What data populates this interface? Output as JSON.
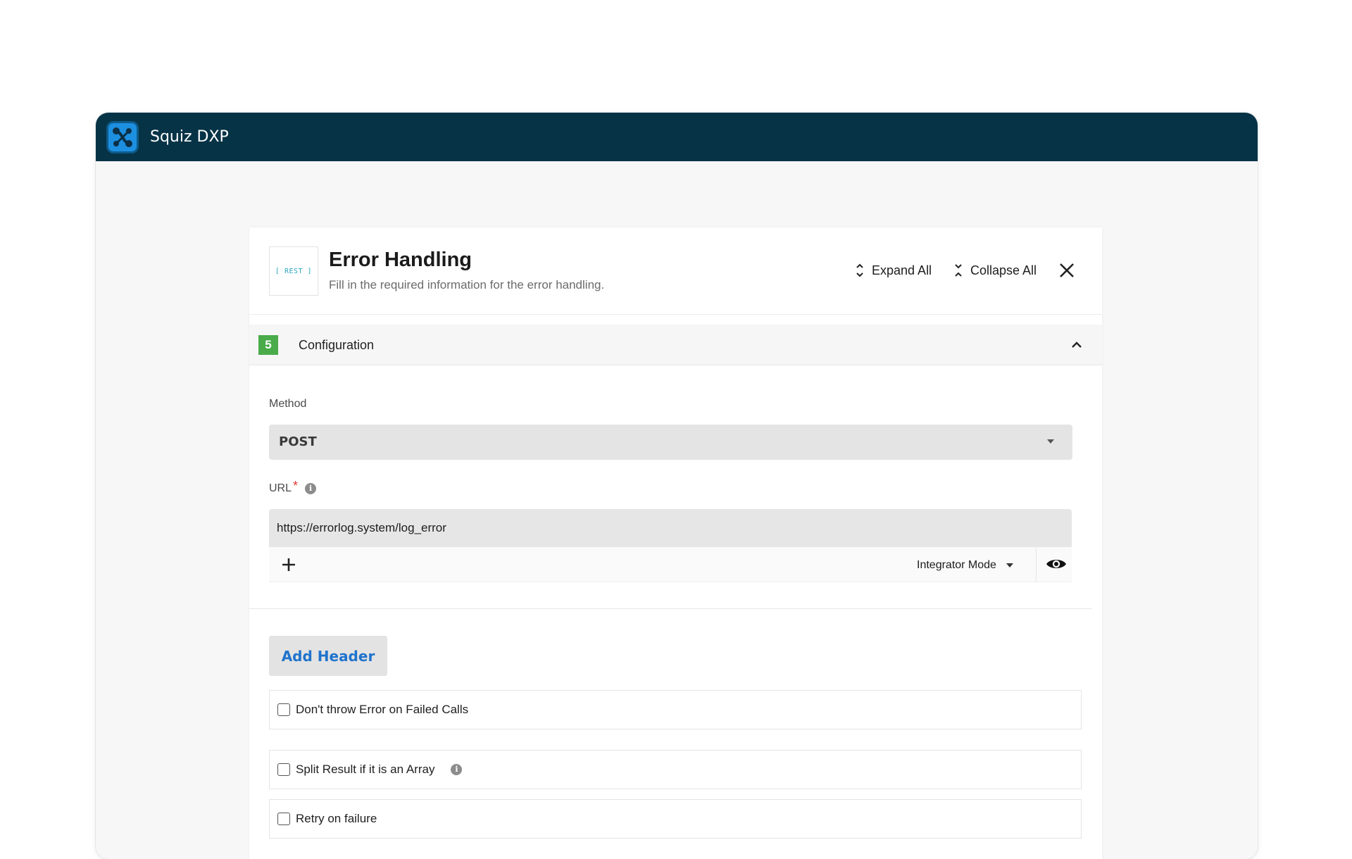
{
  "app": {
    "title": "Squiz DXP",
    "logo_icon": "squiz-logo-icon"
  },
  "panel": {
    "badge": "[ REST ]",
    "title": "Error Handling",
    "subtitle": "Fill in the required information for the error handling.",
    "expand_all_label": "Expand All",
    "collapse_all_label": "Collapse All"
  },
  "section": {
    "step_number": "5",
    "title": "Configuration",
    "expanded": true
  },
  "method": {
    "label": "Method",
    "value": "POST"
  },
  "url": {
    "label": "URL",
    "required_mark": "*",
    "value": "https://errorlog.system/log_error",
    "mode_label": "Integrator Mode"
  },
  "add_header_label": "Add Header",
  "checkboxes": [
    {
      "label": "Don't throw Error on Failed Calls",
      "checked": false
    },
    {
      "label": "Split Result if it is an Array",
      "checked": false,
      "has_info": true
    },
    {
      "label": "Retry on failure",
      "checked": false
    }
  ],
  "colors": {
    "topbar": "#063346",
    "accent_link": "#1f73cc",
    "step_badge": "#4aab4a",
    "required": "#e53935"
  }
}
